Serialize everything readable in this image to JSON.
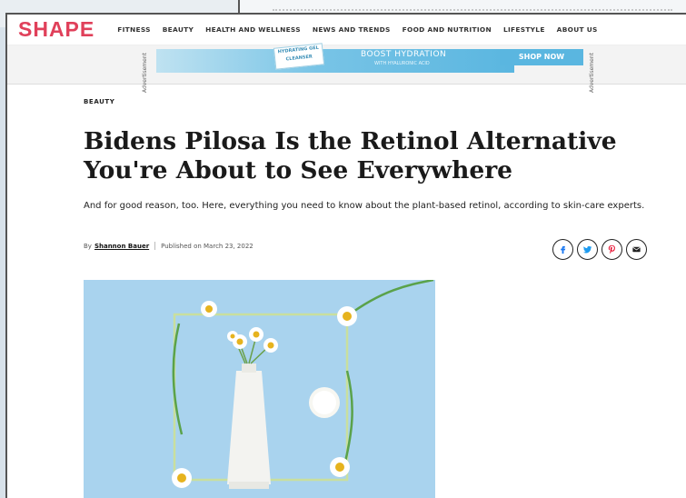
{
  "site": {
    "logo": "SHAPE"
  },
  "nav": {
    "items": [
      "FITNESS",
      "BEAUTY",
      "HEALTH AND WELLNESS",
      "NEWS AND TRENDS",
      "FOOD AND NUTRITION",
      "LIFESTYLE",
      "ABOUT US"
    ]
  },
  "ad": {
    "label": "Advertisement",
    "product_text": "HYDRATING GEL CLEANSER",
    "headline": "BOOST HYDRATION",
    "sub": "WITH HYALURONIC ACID",
    "cta": "SHOP NOW"
  },
  "article": {
    "category": "BEAUTY",
    "title": "Bidens Pilosa Is the Retinol Alternative You're About to See Everywhere",
    "dek": "And for good reason, too. Here, everything you need to know about the plant-based retinol, according to skin-care experts.",
    "byline_prefix": "By",
    "author": "Shannon Bauer",
    "published": "Published on March 23, 2022"
  },
  "share": {
    "icons": [
      "facebook-icon",
      "twitter-icon",
      "pinterest-icon",
      "email-icon"
    ]
  },
  "colors": {
    "brand": "#e0405a",
    "hero_bg": "#a9d3ee"
  }
}
